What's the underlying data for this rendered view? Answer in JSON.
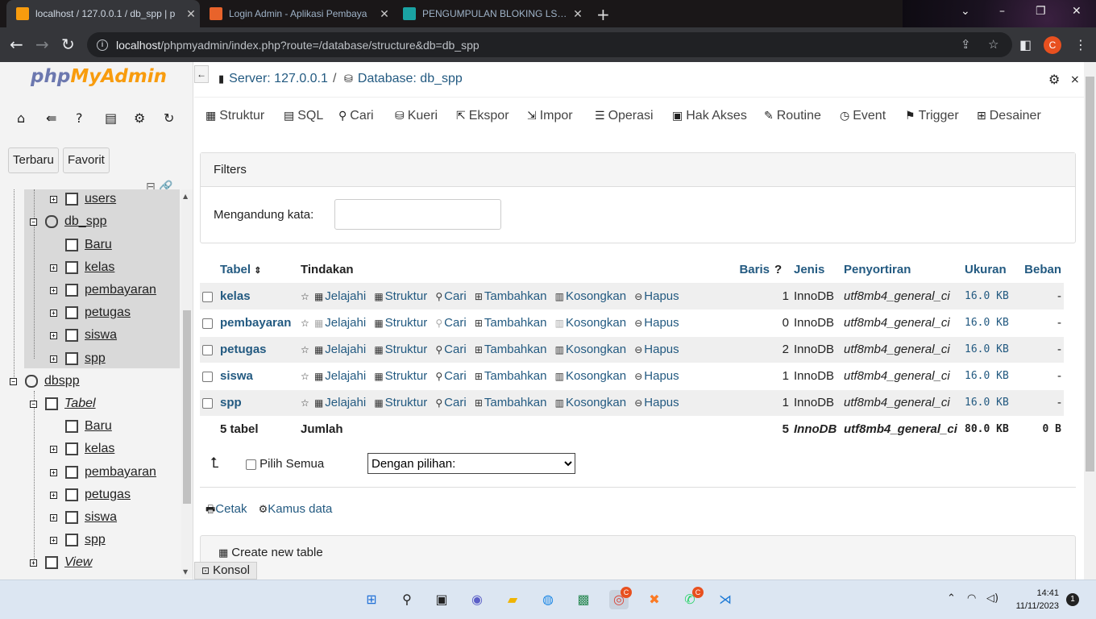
{
  "browser": {
    "tabs": [
      {
        "title": "localhost / 127.0.0.1 / db_spp | p",
        "active": true
      },
      {
        "title": "Login Admin - Aplikasi Pembaya",
        "active": false
      },
      {
        "title": "PENGUMPULAN BLOKING LSP K",
        "active": false
      }
    ],
    "url_host": "localhost",
    "url_path": "/phpmyadmin/index.php?route=/database/structure&db=db_spp",
    "profile_initial": "C"
  },
  "left": {
    "logo_php": "php",
    "logo_myadmin": "MyAdmin",
    "btn_recent": "Terbaru",
    "btn_favorite": "Favorit",
    "tree": {
      "users": "users",
      "db_spp": "db_spp",
      "baru1": "Baru",
      "kelas1": "kelas",
      "pembayaran1": "pembayaran",
      "petugas1": "petugas",
      "siswa1": "siswa",
      "spp1": "spp",
      "dbspp": "dbspp",
      "tabel": "Tabel",
      "baru2": "Baru",
      "kelas2": "kelas",
      "pembayaran2": "pembayaran",
      "petugas2": "petugas",
      "siswa2": "siswa",
      "spp2": "spp",
      "view": "View"
    }
  },
  "breadcrumb": {
    "server": "Server: 127.0.0.1",
    "sep": "/",
    "database": "Database: db_spp"
  },
  "menu": {
    "struktur": "Struktur",
    "sql": "SQL",
    "cari": "Cari",
    "kueri": "Kueri",
    "ekspor": "Ekspor",
    "impor": "Impor",
    "operasi": "Operasi",
    "hak_akses": "Hak Akses",
    "routine": "Routine",
    "event": "Event",
    "trigger": "Trigger",
    "desainer": "Desainer"
  },
  "filters": {
    "heading": "Filters",
    "label": "Mengandung kata:",
    "value": ""
  },
  "table": {
    "headers": {
      "tabel": "Tabel",
      "tindakan": "Tindakan",
      "baris": "Baris",
      "jenis": "Jenis",
      "penyortiran": "Penyortiran",
      "ukuran": "Ukuran",
      "beban": "Beban"
    },
    "actions": {
      "jelajahi": "Jelajahi",
      "struktur": "Struktur",
      "cari": "Cari",
      "tambahkan": "Tambahkan",
      "kosongkan": "Kosongkan",
      "hapus": "Hapus"
    },
    "rows": [
      {
        "name": "kelas",
        "rows": "1",
        "engine": "InnoDB",
        "collation": "utf8mb4_general_ci",
        "size": "16.0 KB",
        "overhead": "-"
      },
      {
        "name": "pembayaran",
        "rows": "0",
        "engine": "InnoDB",
        "collation": "utf8mb4_general_ci",
        "size": "16.0 KB",
        "overhead": "-"
      },
      {
        "name": "petugas",
        "rows": "2",
        "engine": "InnoDB",
        "collation": "utf8mb4_general_ci",
        "size": "16.0 KB",
        "overhead": "-"
      },
      {
        "name": "siswa",
        "rows": "1",
        "engine": "InnoDB",
        "collation": "utf8mb4_general_ci",
        "size": "16.0 KB",
        "overhead": "-"
      },
      {
        "name": "spp",
        "rows": "1",
        "engine": "InnoDB",
        "collation": "utf8mb4_general_ci",
        "size": "16.0 KB",
        "overhead": "-"
      }
    ],
    "total": {
      "label": "5 tabel",
      "sum_label": "Jumlah",
      "rows": "5",
      "engine": "InnoDB",
      "collation": "utf8mb4_general_ci",
      "size": "80.0 KB",
      "overhead": "0 B"
    }
  },
  "bulk": {
    "select_all": "Pilih Semua",
    "with_selected": "Dengan pilihan:"
  },
  "links": {
    "print": "Cetak",
    "dictionary": "Kamus data"
  },
  "create_table": "Create new table",
  "console": "Konsol",
  "taskbar": {
    "time": "14:41",
    "date": "11/11/2023",
    "notifications": "1",
    "chrome_badge": "C",
    "whatsapp_badge": "C"
  },
  "colors": {
    "link": "#235a81",
    "chrome_dark": "#35363a",
    "logo_blue": "#6c78af",
    "logo_orange": "#f89c0e"
  }
}
